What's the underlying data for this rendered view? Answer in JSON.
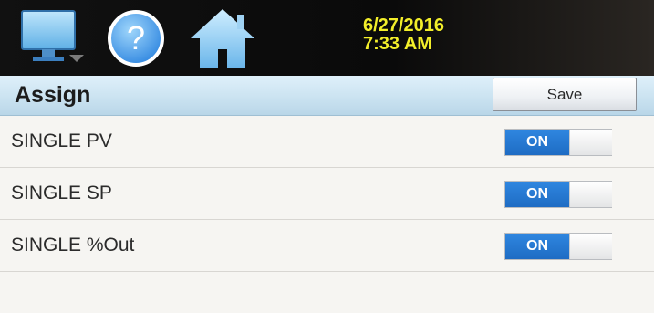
{
  "header": {
    "date": "6/27/2016",
    "time": "7:33 AM",
    "icons": [
      "monitor-icon",
      "help-icon",
      "home-icon"
    ]
  },
  "page": {
    "title": "Assign",
    "save_label": "Save"
  },
  "rows": [
    {
      "label": "SINGLE PV",
      "toggle": "ON"
    },
    {
      "label": "SINGLE SP",
      "toggle": "ON"
    },
    {
      "label": "SINGLE %Out",
      "toggle": "ON"
    }
  ],
  "colors": {
    "datetime": "#f2ee2a",
    "toggle_on": "#2f86e0",
    "titlebar": "#cbe3f1"
  }
}
